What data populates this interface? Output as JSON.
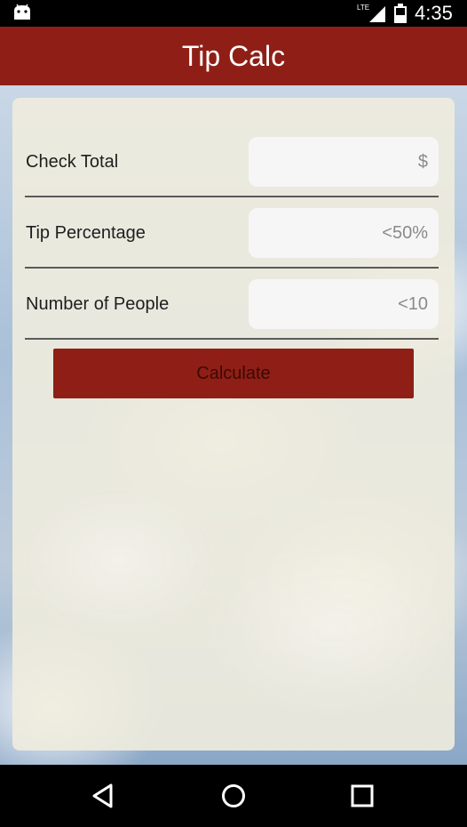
{
  "status_bar": {
    "time": "4:35",
    "network": "LTE"
  },
  "app_bar": {
    "title": "Tip Calc",
    "color": "#8f1f16"
  },
  "form": {
    "check_total": {
      "label": "Check Total",
      "value": "",
      "placeholder": "$"
    },
    "tip_percentage": {
      "label": "Tip Percentage",
      "value": "",
      "placeholder": "<50%"
    },
    "number_of_people": {
      "label": "Number of People",
      "value": "",
      "placeholder": "<10"
    },
    "calculate_label": "Calculate"
  },
  "nav_bar": {
    "icons": [
      "back-icon",
      "home-icon",
      "recents-icon"
    ]
  }
}
